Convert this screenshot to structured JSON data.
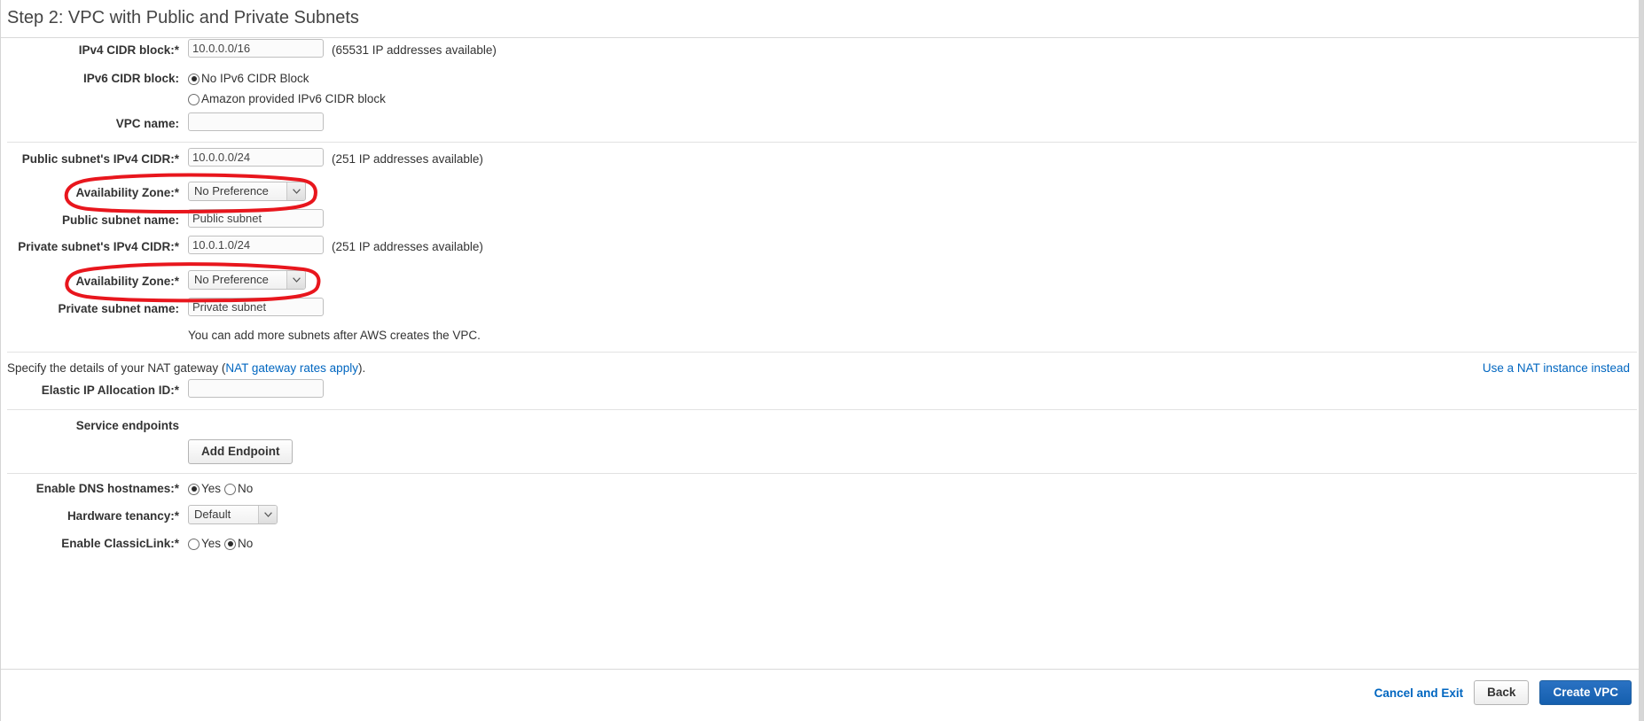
{
  "header": {
    "title": "Step 2: VPC with Public and Private Subnets"
  },
  "vpc_section": {
    "ipv4_cidr": {
      "label": "IPv4 CIDR block:*",
      "value": "10.0.0.0/16",
      "hint": "(65531 IP addresses available)"
    },
    "ipv6_cidr": {
      "label": "IPv6 CIDR block:",
      "options": [
        {
          "label": "No IPv6 CIDR Block",
          "selected": true
        },
        {
          "label": "Amazon provided IPv6 CIDR block",
          "selected": false
        }
      ]
    },
    "vpc_name": {
      "label": "VPC name:",
      "value": "",
      "placeholder": ""
    }
  },
  "subnet_section": {
    "public_cidr": {
      "label": "Public subnet's IPv4 CIDR:*",
      "value": "10.0.0.0/24",
      "hint": "(251 IP addresses available)"
    },
    "public_az": {
      "label": "Availability Zone:*",
      "value": "No Preference",
      "options": [
        "No Preference"
      ]
    },
    "public_subnet_name": {
      "label": "Public subnet name:",
      "value": "Public subnet"
    },
    "private_cidr": {
      "label": "Private subnet's IPv4 CIDR:*",
      "value": "10.0.1.0/24",
      "hint": "(251 IP addresses available)"
    },
    "private_az": {
      "label": "Availability Zone:*",
      "value": "No Preference",
      "options": [
        "No Preference"
      ]
    },
    "private_subnet_name": {
      "label": "Private subnet name:",
      "value": "Private subnet"
    },
    "note": "You can add more subnets after AWS creates the VPC."
  },
  "nat_section": {
    "description_prefix": "Specify the details of your NAT gateway (",
    "rates_link": "NAT gateway rates apply",
    "description_suffix": ").",
    "nat_instance_link": "Use a NAT instance instead",
    "elastic_ip": {
      "label": "Elastic IP Allocation ID:*",
      "value": ""
    }
  },
  "endpoints_section": {
    "label": "Service endpoints",
    "add_endpoint_button": "Add Endpoint"
  },
  "options_section": {
    "dns_hostnames": {
      "label": "Enable DNS hostnames:*",
      "options": [
        {
          "label": "Yes",
          "selected": true
        },
        {
          "label": "No",
          "selected": false
        }
      ]
    },
    "hardware_tenancy": {
      "label": "Hardware tenancy:*",
      "value": "Default",
      "options": [
        "Default"
      ]
    },
    "classiclink": {
      "label": "Enable ClassicLink:*",
      "options": [
        {
          "label": "Yes",
          "selected": false
        },
        {
          "label": "No",
          "selected": true
        }
      ]
    }
  },
  "footer": {
    "cancel_label": "Cancel and Exit",
    "back_label": "Back",
    "create_label": "Create VPC"
  },
  "annotations": {
    "color": "#e8161d",
    "items": [
      {
        "name": "public-az-highlight"
      },
      {
        "name": "private-az-highlight"
      }
    ]
  }
}
